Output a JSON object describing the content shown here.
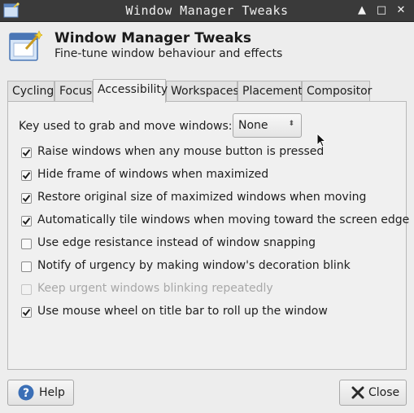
{
  "window": {
    "title": "Window Manager Tweaks",
    "buttons": {
      "roll_up": "▲",
      "maximize": "□",
      "close": "✕"
    }
  },
  "header": {
    "title": "Window Manager Tweaks",
    "subtitle": "Fine-tune window behaviour and effects"
  },
  "tabs": [
    {
      "label": "Cycling",
      "active": false
    },
    {
      "label": "Focus",
      "active": false
    },
    {
      "label": "Accessibility",
      "active": true
    },
    {
      "label": "Workspaces",
      "active": false
    },
    {
      "label": "Placement",
      "active": false
    },
    {
      "label": "Compositor",
      "active": false
    }
  ],
  "accessibility": {
    "key_label": "Key used to grab and move windows:",
    "key_value": "None",
    "options": [
      {
        "label": "Raise windows when any mouse button is pressed",
        "checked": true,
        "enabled": true
      },
      {
        "label": "Hide frame of windows when maximized",
        "checked": true,
        "enabled": true
      },
      {
        "label": "Restore original size of maximized windows when moving",
        "checked": true,
        "enabled": true
      },
      {
        "label": "Automatically tile windows when moving toward the screen edge",
        "checked": true,
        "enabled": true
      },
      {
        "label": "Use edge resistance instead of window snapping",
        "checked": false,
        "enabled": true
      },
      {
        "label": "Notify of urgency by making window's decoration blink",
        "checked": false,
        "enabled": true
      },
      {
        "label": "Keep urgent windows blinking repeatedly",
        "checked": false,
        "enabled": false
      },
      {
        "label": "Use mouse wheel on title bar to roll up the window",
        "checked": true,
        "enabled": true
      }
    ]
  },
  "footer": {
    "help_label": "Help",
    "close_label": "Close"
  },
  "colors": {
    "titlebar_bg": "#3a3a3a",
    "window_bg": "#ededed",
    "help_icon": "#3b6fb6",
    "close_icon": "#2a2a2a"
  },
  "icons": {
    "app": "window-manager-tweaks-icon",
    "help": "help-question-icon",
    "close": "close-x-icon"
  }
}
